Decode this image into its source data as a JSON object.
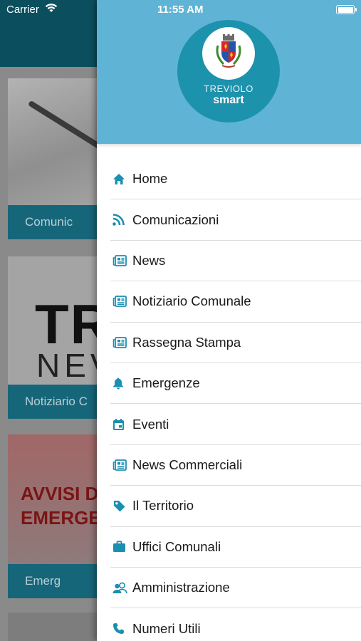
{
  "status_bar": {
    "carrier": "Carrier",
    "time": "11:55 AM",
    "wifi_icon": "wifi-icon",
    "battery_icon": "battery-icon",
    "battery_level": 1.0
  },
  "background": {
    "cards": [
      {
        "caption": "Comunic"
      },
      {
        "caption": "Notiziario C",
        "image_text_big": "TR",
        "image_text_small": "NEV"
      },
      {
        "caption": "Emerg",
        "image_text": "AVVISI D EMERGE"
      },
      {
        "caption": ""
      }
    ]
  },
  "drawer": {
    "logo": {
      "name": "TREVIOLO",
      "tagline": "smart"
    },
    "items": [
      {
        "label": "Home",
        "icon": "home-icon"
      },
      {
        "label": "Comunicazioni",
        "icon": "rss-icon"
      },
      {
        "label": "News",
        "icon": "newspaper-icon"
      },
      {
        "label": "Notiziario Comunale",
        "icon": "newspaper-icon"
      },
      {
        "label": "Rassegna Stampa",
        "icon": "newspaper-icon"
      },
      {
        "label": "Emergenze",
        "icon": "bell-icon"
      },
      {
        "label": "Eventi",
        "icon": "calendar-icon"
      },
      {
        "label": "News Commerciali",
        "icon": "newspaper-icon"
      },
      {
        "label": "Il Territorio",
        "icon": "tag-icon"
      },
      {
        "label": "Uffici Comunali",
        "icon": "briefcase-icon"
      },
      {
        "label": "Amministrazione",
        "icon": "people-icon"
      },
      {
        "label": "Numeri Utili",
        "icon": "phone-icon"
      }
    ]
  },
  "colors": {
    "accent": "#1d92ad",
    "header": "#5fb4d6",
    "icon": "#1b8fb0"
  }
}
